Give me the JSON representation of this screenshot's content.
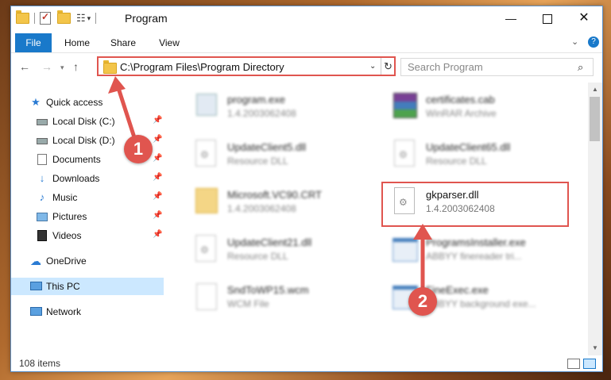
{
  "window": {
    "title": "Program",
    "controls": {
      "minimize": "—",
      "maximize": "",
      "close": "✕"
    }
  },
  "ribbon": {
    "tabs": [
      "File",
      "Home",
      "Share",
      "View"
    ],
    "help": "?"
  },
  "address": {
    "path": "C:\\Program Files\\Program Directory",
    "search_placeholder": "Search Program"
  },
  "nav_pane": {
    "items": [
      {
        "label": "Quick access",
        "icon": "star-icon",
        "pinned": false
      },
      {
        "label": "Local Disk (C:)",
        "icon": "drive-icon",
        "pinned": true
      },
      {
        "label": "Local Disk (D:)",
        "icon": "drive-icon",
        "pinned": true
      },
      {
        "label": "Documents",
        "icon": "documents-icon",
        "pinned": true
      },
      {
        "label": "Downloads",
        "icon": "downloads-icon",
        "pinned": true
      },
      {
        "label": "Music",
        "icon": "music-icon",
        "pinned": true
      },
      {
        "label": "Pictures",
        "icon": "pictures-icon",
        "pinned": true
      },
      {
        "label": "Videos",
        "icon": "videos-icon",
        "pinned": true
      },
      {
        "label": "OneDrive",
        "icon": "onedrive-icon",
        "pinned": false
      },
      {
        "label": "This PC",
        "icon": "pc-icon",
        "pinned": false,
        "selected": true
      },
      {
        "label": "Network",
        "icon": "network-icon",
        "pinned": false
      }
    ]
  },
  "files": [
    {
      "name": "program.exe",
      "meta": "1.4.2003062408",
      "icon": "exe-icon"
    },
    {
      "name": "certificates.cab",
      "meta": "WinRAR Archive",
      "icon": "winrar-icon"
    },
    {
      "name": "UpdateClient5.dll",
      "meta": "Resource DLL",
      "icon": "dll-icon"
    },
    {
      "name": "UpdateClient65.dll",
      "meta": "Resource DLL",
      "icon": "dll-icon"
    },
    {
      "name": "Microsoft.VC90.CRT",
      "meta": "1.4.2003062408",
      "icon": "folder-icon"
    },
    {
      "name": "gkparser.dll",
      "meta": "1.4.2003062408",
      "icon": "dll-icon",
      "highlighted": true
    },
    {
      "name": "UpdateClient21.dll",
      "meta": "Resource DLL",
      "icon": "dll-icon"
    },
    {
      "name": "ProgramsInstaller.exe",
      "meta": "ABBYY finereader tri...",
      "icon": "exe-icon"
    },
    {
      "name": "SndToWP15.wcm",
      "meta": "WCM File",
      "icon": "file-icon"
    },
    {
      "name": "FineExec.exe",
      "meta": "ABBYY background exe...",
      "icon": "exe-icon"
    }
  ],
  "status": {
    "items_count": "108 items"
  },
  "annotations": {
    "badge_1": "1",
    "badge_2": "2"
  },
  "colors": {
    "accent": "#1979ca",
    "annotation": "#e0554f",
    "selected": "#cce8ff"
  }
}
